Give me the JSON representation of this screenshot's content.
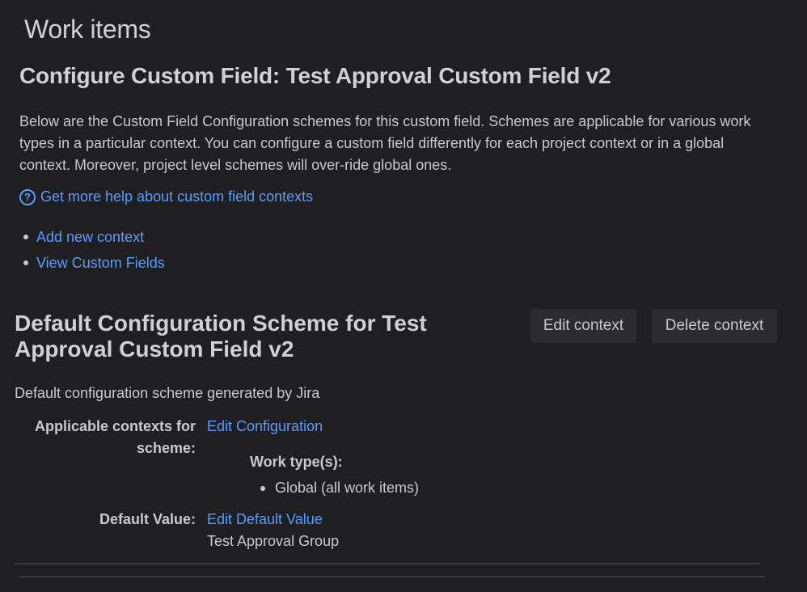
{
  "section_title": "Work items",
  "page_heading": "Configure Custom Field: Test Approval Custom Field v2",
  "intro": "Below are the Custom Field Configuration schemes for this custom field. Schemes are applicable for various work types in a particular context. You can configure a custom field differently for each project context or in a global context. Moreover, project level schemes will over-ride global ones.",
  "help_link": "Get more help about custom field contexts",
  "help_icon": "question-circle-icon",
  "actions": {
    "add_context": "Add new context",
    "view_fields": "View Custom Fields"
  },
  "scheme": {
    "title": "Default Configuration Scheme for Test Approval Custom Field v2",
    "edit_button": "Edit context",
    "delete_button": "Delete context",
    "description": "Default configuration scheme generated by Jira",
    "contexts_label": "Applicable contexts for scheme:",
    "edit_configuration": "Edit Configuration",
    "worktypes_label": "Work type(s):",
    "worktypes": [
      "Global (all work items)"
    ],
    "default_value_label": "Default Value:",
    "edit_default_value": "Edit Default Value",
    "default_value": "Test Approval Group"
  },
  "colors": {
    "background": "#1f1f21",
    "link": "#579dff",
    "button_bg": "#2c2c2f"
  }
}
